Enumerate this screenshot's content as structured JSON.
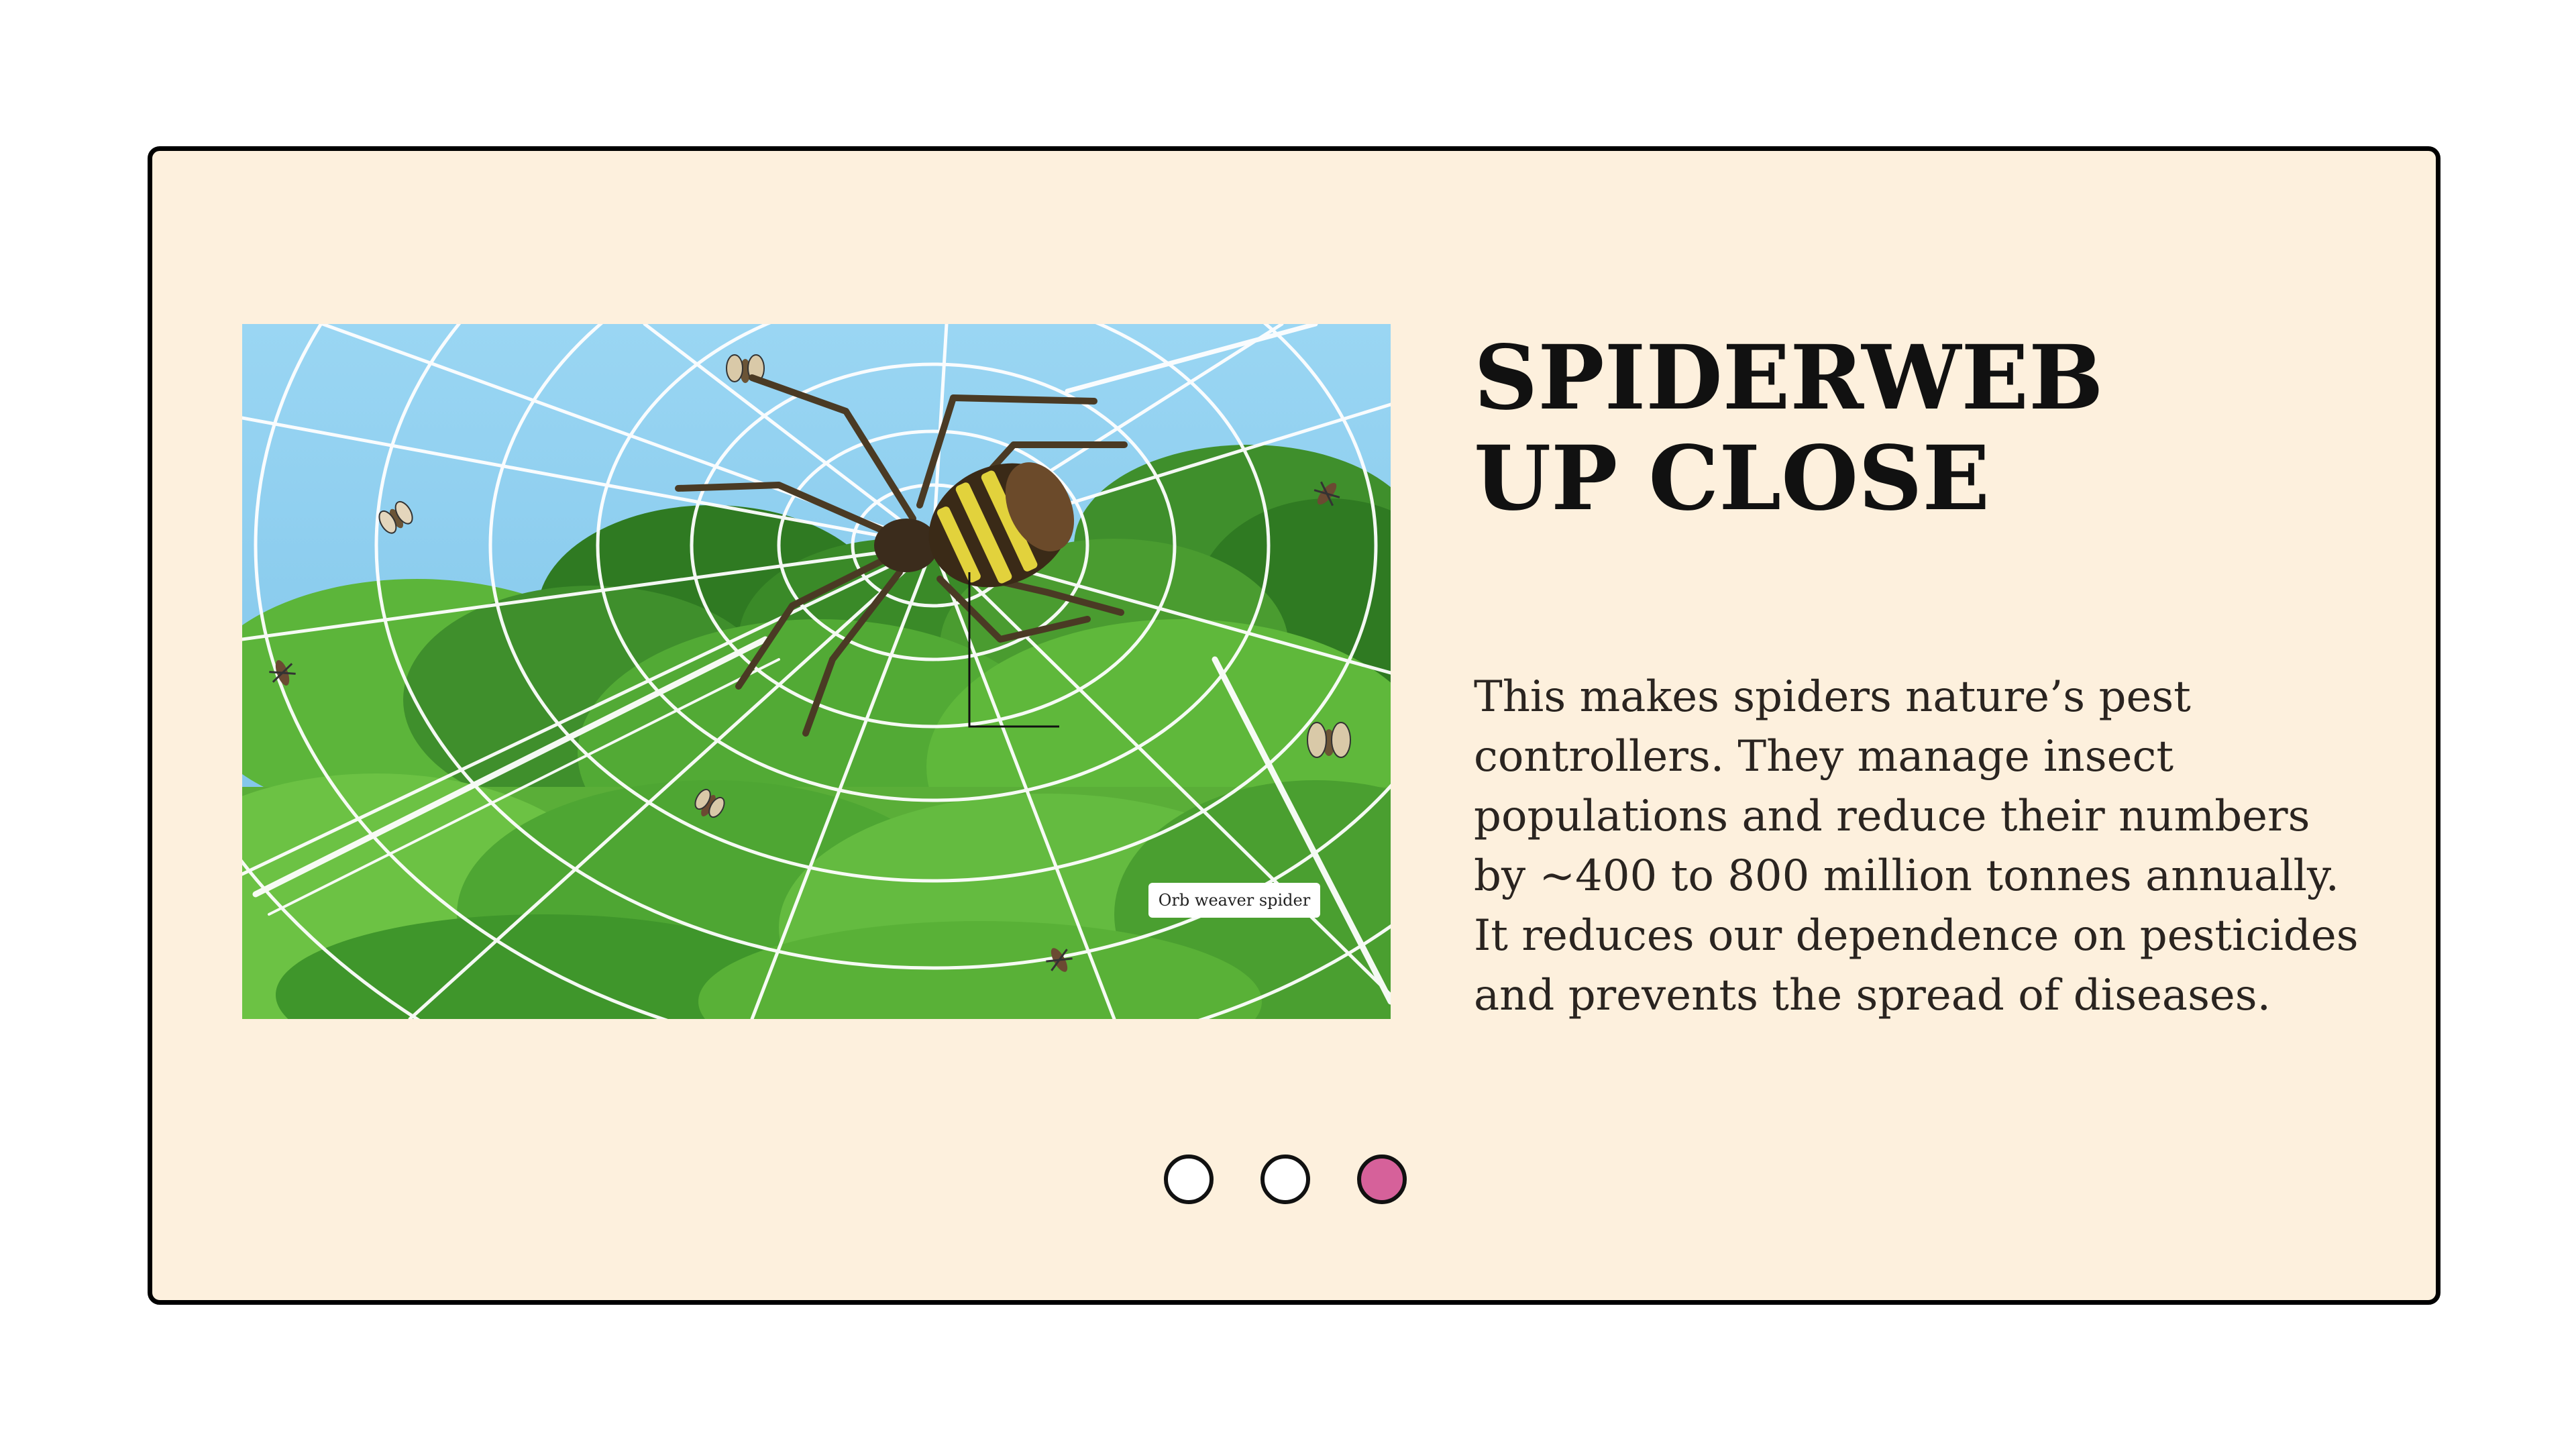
{
  "slide": {
    "title_lines": [
      "SPIDERWEB",
      "UP CLOSE"
    ],
    "body_lines": [
      "This makes spiders nature’s pest",
      "controllers. They manage insect",
      "populations and reduce their numbers",
      "by ~400 to 800 million tonnes annually.",
      "It reduces our dependence on pesticides",
      "and prevents the spread of diseases."
    ],
    "image": {
      "callout_label": "Orb weaver spider"
    }
  },
  "pagination": {
    "total": 3,
    "active_index": 2,
    "active_color": "#d6619a"
  },
  "colors": {
    "card_background": "#fdf0dd",
    "card_border": "#000000",
    "sky": "#8fd0ef",
    "foliage": "#4fa836"
  }
}
